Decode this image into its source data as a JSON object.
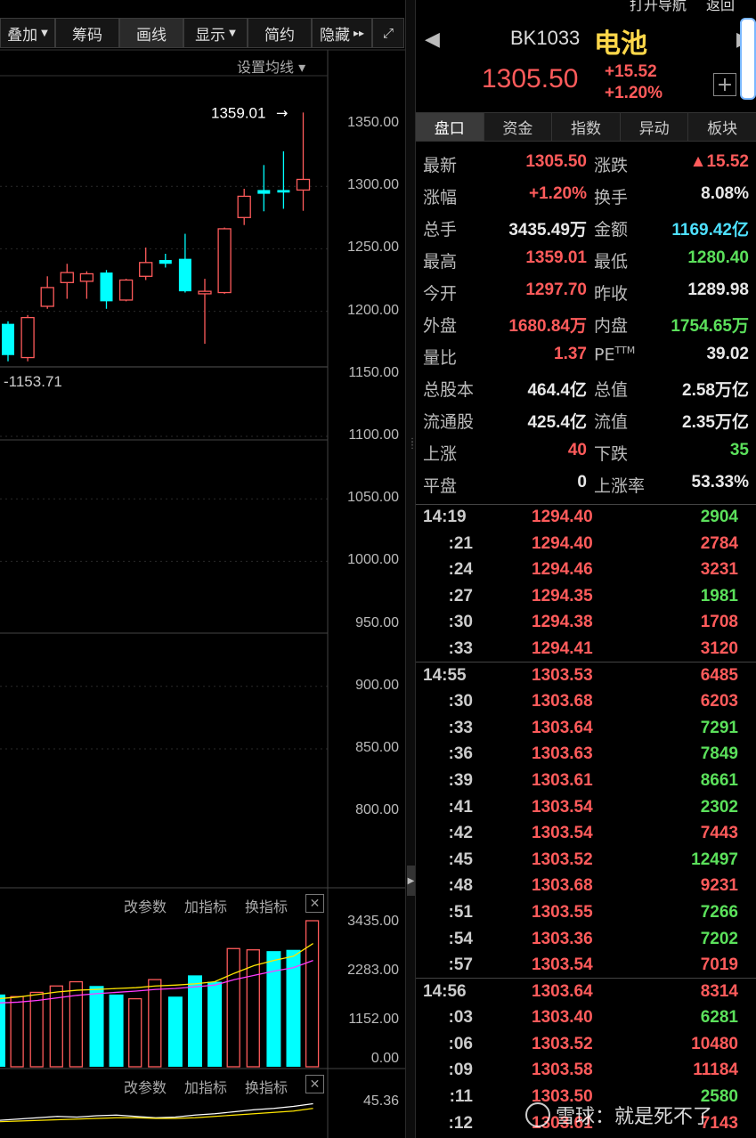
{
  "toolbar": {
    "items": [
      {
        "label": "叠加",
        "dropdown": true
      },
      {
        "label": "筹码",
        "dropdown": false
      },
      {
        "label": "画线",
        "dropdown": false
      },
      {
        "label": "显示",
        "dropdown": true
      },
      {
        "label": "简约",
        "dropdown": false
      },
      {
        "label": "隐藏",
        "dropdown": false
      }
    ],
    "ma_setting": "设置均线 ▾"
  },
  "chart_data": [
    {
      "type": "candlestick",
      "title": "",
      "high_label": "1359.01",
      "low_label": "1153.71",
      "y_ticks": [
        1350,
        1300,
        1250,
        1200,
        1150,
        1100,
        1050,
        1000,
        950,
        900,
        850,
        800
      ],
      "y_tick_labels": [
        "1350.00",
        "1300.00",
        "1250.00",
        "1200.00",
        "1150.00",
        "1100.00",
        "1050.00",
        "1000.00",
        "950.00",
        "900.00",
        "850.00",
        "800.00"
      ],
      "ylim": [
        780,
        1380
      ],
      "candles": [
        {
          "o": 1165,
          "c": 1190,
          "h": 1192,
          "l": 1160,
          "up": false
        },
        {
          "o": 1163,
          "c": 1195,
          "h": 1197,
          "l": 1160,
          "up": true
        },
        {
          "o": 1204,
          "c": 1219,
          "h": 1228,
          "l": 1202,
          "up": true
        },
        {
          "o": 1223,
          "c": 1231,
          "h": 1238,
          "l": 1210,
          "up": true
        },
        {
          "o": 1224,
          "c": 1230,
          "h": 1232,
          "l": 1210,
          "up": true
        },
        {
          "o": 1231,
          "c": 1208,
          "h": 1233,
          "l": 1202,
          "up": false
        },
        {
          "o": 1209,
          "c": 1225,
          "h": 1226,
          "l": 1208,
          "up": true
        },
        {
          "o": 1228,
          "c": 1239,
          "h": 1251,
          "l": 1225,
          "up": true
        },
        {
          "o": 1241,
          "c": 1238,
          "h": 1246,
          "l": 1235,
          "up": false
        },
        {
          "o": 1242,
          "c": 1216,
          "h": 1262,
          "l": 1215,
          "up": false
        },
        {
          "o": 1214,
          "c": 1216,
          "h": 1226,
          "l": 1174,
          "up": true
        },
        {
          "o": 1215,
          "c": 1266,
          "h": 1267,
          "l": 1214,
          "up": true
        },
        {
          "o": 1275,
          "c": 1292,
          "h": 1298,
          "l": 1269,
          "up": true
        },
        {
          "o": 1294,
          "c": 1297,
          "h": 1317,
          "l": 1280,
          "up": false
        },
        {
          "o": 1295,
          "c": 1297,
          "h": 1328,
          "l": 1282,
          "up": false
        },
        {
          "o": 1297,
          "c": 1305.5,
          "h": 1359.01,
          "l": 1280.4,
          "up": true
        }
      ]
    },
    {
      "type": "bar",
      "title": "",
      "y_tick_labels": [
        "3435.00",
        "2283.00",
        "1152.00",
        "0.00"
      ],
      "ylim": [
        0,
        3435
      ],
      "values": [
        1700,
        1650,
        1750,
        1900,
        2000,
        1900,
        1700,
        1600,
        2050,
        1650,
        2150,
        2000,
        2780,
        2750,
        2720,
        2750,
        3435
      ],
      "up": [
        false,
        true,
        true,
        true,
        true,
        false,
        false,
        true,
        true,
        false,
        false,
        false,
        true,
        true,
        false,
        false,
        true
      ],
      "ma1": [
        1600,
        1640,
        1700,
        1760,
        1800,
        1820,
        1840,
        1860,
        1900,
        1920,
        1950,
        2000,
        2200,
        2380,
        2500,
        2600,
        2900
      ],
      "ma2": [
        1500,
        1520,
        1560,
        1620,
        1680,
        1720,
        1750,
        1780,
        1820,
        1840,
        1880,
        1920,
        2050,
        2150,
        2250,
        2330,
        2500
      ]
    },
    {
      "type": "line",
      "title": "",
      "y_tick_labels": [
        "45.36"
      ],
      "series_white": [
        20,
        22,
        24,
        26,
        25,
        27,
        28,
        26,
        24,
        25,
        28,
        30,
        33,
        36,
        38,
        41,
        45
      ],
      "series_yellow": [
        18,
        19,
        20,
        21,
        22,
        23,
        24,
        24,
        23,
        23,
        24,
        26,
        28,
        30,
        32,
        34,
        38
      ]
    }
  ],
  "indicators": {
    "links": [
      "改参数",
      "加指标",
      "换指标"
    ]
  },
  "header": {
    "topnav": [
      "打开导航",
      "返回"
    ],
    "code": "BK1033",
    "name": "电池",
    "price": "1305.50",
    "change": "+15.52",
    "change_pct": "+1.20%"
  },
  "tabs": [
    "盘口",
    "资金",
    "指数",
    "异动",
    "板块"
  ],
  "quote": [
    {
      "l1": "最新",
      "v1": "1305.50",
      "c1": "#ff5b5b",
      "l2": "涨跌",
      "v2": "▲15.52",
      "c2": "#ff5b5b"
    },
    {
      "l1": "涨幅",
      "v1": "+1.20%",
      "c1": "#ff5b5b",
      "l2": "换手",
      "v2": "8.08%",
      "c2": "#e8e8e8"
    },
    {
      "l1": "总手",
      "v1": "3435.49万",
      "c1": "#e8e8e8",
      "l2": "金额",
      "v2": "1169.42亿",
      "c2": "#4ee0ff"
    },
    {
      "l1": "最高",
      "v1": "1359.01",
      "c1": "#ff5b5b",
      "l2": "最低",
      "v2": "1280.40",
      "c2": "#5be05b"
    },
    {
      "l1": "今开",
      "v1": "1297.70",
      "c1": "#ff5b5b",
      "l2": "昨收",
      "v2": "1289.98",
      "c2": "#e8e8e8"
    },
    {
      "l1": "外盘",
      "v1": "1680.84万",
      "c1": "#ff5b5b",
      "l2": "内盘",
      "v2": "1754.65万",
      "c2": "#5be05b"
    },
    {
      "l1": "量比",
      "v1": "1.37",
      "c1": "#ff5b5b",
      "l2": "PE",
      "l2sup": "TTM",
      "v2": "39.02",
      "c2": "#e8e8e8"
    },
    {
      "l1": "总股本",
      "v1": "464.4亿",
      "c1": "#e8e8e8",
      "l2": "总值",
      "v2": "2.58万亿",
      "c2": "#e8e8e8"
    },
    {
      "l1": "流通股",
      "v1": "425.4亿",
      "c1": "#e8e8e8",
      "l2": "流值",
      "v2": "2.35万亿",
      "c2": "#e8e8e8"
    },
    {
      "l1": "上涨",
      "v1": "40",
      "c1": "#ff5b5b",
      "l2": "下跌",
      "v2": "35",
      "c2": "#5be05b"
    },
    {
      "l1": "平盘",
      "v1": "0",
      "c1": "#e8e8e8",
      "l2": "上涨率",
      "v2": "53.33%",
      "c2": "#e8e8e8"
    }
  ],
  "ticks": [
    {
      "t": "14:19",
      "p": "1294.40",
      "v": "2904",
      "vc": "#5be05b"
    },
    {
      "t": ":21",
      "p": "1294.40",
      "v": "2784",
      "vc": "#ff5b5b"
    },
    {
      "t": ":24",
      "p": "1294.46",
      "v": "3231",
      "vc": "#ff5b5b"
    },
    {
      "t": ":27",
      "p": "1294.35",
      "v": "1981",
      "vc": "#5be05b"
    },
    {
      "t": ":30",
      "p": "1294.38",
      "v": "1708",
      "vc": "#ff5b5b"
    },
    {
      "t": ":33",
      "p": "1294.41",
      "v": "3120",
      "vc": "#ff5b5b"
    },
    {
      "t": "14:55",
      "p": "1303.53",
      "v": "6485",
      "vc": "#ff5b5b"
    },
    {
      "t": ":30",
      "p": "1303.68",
      "v": "6203",
      "vc": "#ff5b5b"
    },
    {
      "t": ":33",
      "p": "1303.64",
      "v": "7291",
      "vc": "#5be05b"
    },
    {
      "t": ":36",
      "p": "1303.63",
      "v": "7849",
      "vc": "#5be05b"
    },
    {
      "t": ":39",
      "p": "1303.61",
      "v": "8661",
      "vc": "#5be05b"
    },
    {
      "t": ":41",
      "p": "1303.54",
      "v": "2302",
      "vc": "#5be05b"
    },
    {
      "t": ":42",
      "p": "1303.54",
      "v": "7443",
      "vc": "#ff5b5b"
    },
    {
      "t": ":45",
      "p": "1303.52",
      "v": "12497",
      "vc": "#5be05b"
    },
    {
      "t": ":48",
      "p": "1303.68",
      "v": "9231",
      "vc": "#ff5b5b"
    },
    {
      "t": ":51",
      "p": "1303.55",
      "v": "7266",
      "vc": "#5be05b"
    },
    {
      "t": ":54",
      "p": "1303.36",
      "v": "7202",
      "vc": "#5be05b"
    },
    {
      "t": ":57",
      "p": "1303.54",
      "v": "7019",
      "vc": "#ff5b5b"
    },
    {
      "t": "14:56",
      "p": "1303.64",
      "v": "8314",
      "vc": "#ff5b5b"
    },
    {
      "t": ":03",
      "p": "1303.40",
      "v": "6281",
      "vc": "#5be05b"
    },
    {
      "t": ":06",
      "p": "1303.52",
      "v": "10480",
      "vc": "#ff5b5b"
    },
    {
      "t": ":09",
      "p": "1303.58",
      "v": "11184",
      "vc": "#ff5b5b"
    },
    {
      "t": ":11",
      "p": "1303.50",
      "v": "2580",
      "vc": "#5be05b"
    },
    {
      "t": ":12",
      "p": "1303.61",
      "v": "7143",
      "vc": "#ff5b5b"
    }
  ],
  "watermark": "雪球：就是死不了"
}
